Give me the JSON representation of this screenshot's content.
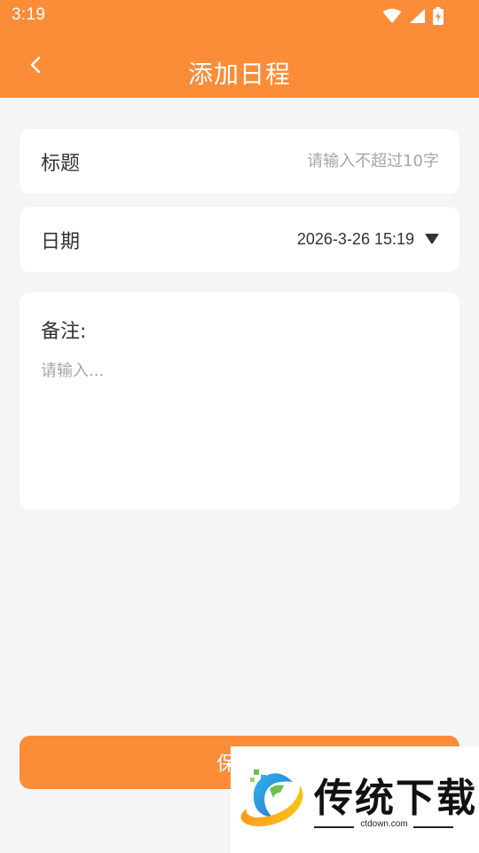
{
  "status_bar": {
    "time": "3:19",
    "icons": [
      "wifi-icon",
      "cellular-signal-icon",
      "battery-charging-icon"
    ]
  },
  "header": {
    "back_icon": "chevron-left-icon",
    "title": "添加日程"
  },
  "form": {
    "title_field": {
      "label": "标题",
      "value": "",
      "placeholder": "请输入不超过10字"
    },
    "date_field": {
      "label": "日期",
      "value": "2026-3-26 15:19",
      "dropdown_icon": "triangle-down-icon"
    },
    "note_field": {
      "label": "备注:",
      "value": "",
      "placeholder": "请输入..."
    }
  },
  "save_button": {
    "label": "保存"
  },
  "watermark": {
    "text": "传统下载",
    "url": "ctdown.com"
  },
  "colors": {
    "accent": "#fb8c38",
    "background": "#f5f5f5",
    "card": "#ffffff",
    "text": "#333333",
    "placeholder": "#a6a6a6"
  }
}
